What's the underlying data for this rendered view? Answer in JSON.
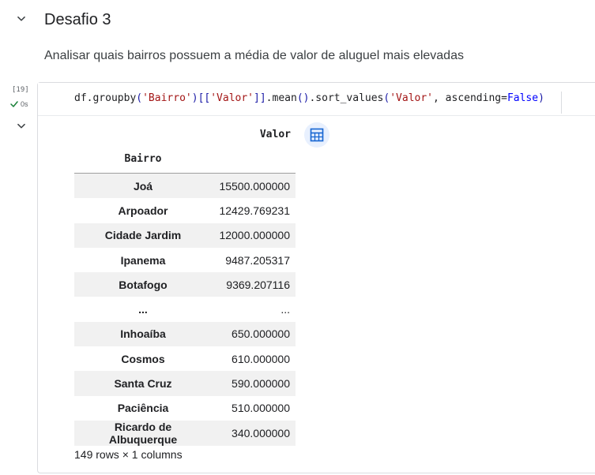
{
  "section": {
    "title": "Desafio 3",
    "text": "Analisar quais bairros possuem a média de valor de aluguel mais elevadas"
  },
  "cell": {
    "execution_count": "[19]",
    "exec_time": "0s",
    "code_tokens": [
      {
        "t": "df.groupby",
        "c": ""
      },
      {
        "t": "(",
        "c": "br"
      },
      {
        "t": "'Bairro'",
        "c": "str"
      },
      {
        "t": ")",
        "c": "br"
      },
      {
        "t": "[[",
        "c": "br"
      },
      {
        "t": "'Valor'",
        "c": "str"
      },
      {
        "t": "]]",
        "c": "br"
      },
      {
        "t": ".mean",
        "c": ""
      },
      {
        "t": "()",
        "c": "br"
      },
      {
        "t": ".sort_values",
        "c": ""
      },
      {
        "t": "(",
        "c": "br"
      },
      {
        "t": "'Valor'",
        "c": "str"
      },
      {
        "t": ", ascending=",
        "c": ""
      },
      {
        "t": "False",
        "c": "kw"
      },
      {
        "t": ")",
        "c": "br"
      }
    ]
  },
  "output": {
    "column_header": "Valor",
    "index_header": "Bairro",
    "rows": [
      {
        "index": "Joá",
        "value": "15500.000000"
      },
      {
        "index": "Arpoador",
        "value": "12429.769231"
      },
      {
        "index": "Cidade Jardim",
        "value": "12000.000000"
      },
      {
        "index": "Ipanema",
        "value": "9487.205317"
      },
      {
        "index": "Botafogo",
        "value": "9369.207116"
      },
      {
        "index": "...",
        "value": "..."
      },
      {
        "index": "Inhoaíba",
        "value": "650.000000"
      },
      {
        "index": "Cosmos",
        "value": "610.000000"
      },
      {
        "index": "Santa Cruz",
        "value": "590.000000"
      },
      {
        "index": "Paciência",
        "value": "510.000000"
      },
      {
        "index": "Ricardo de Albuquerque",
        "value": "340.000000"
      }
    ],
    "shape_info": "149 rows × 1 columns"
  },
  "icons": {
    "collapse": "chevron-down-icon",
    "status": "check-icon",
    "table": "table-icon"
  },
  "colors": {
    "status_check": "#188038",
    "table_icon": "#1967d2"
  }
}
